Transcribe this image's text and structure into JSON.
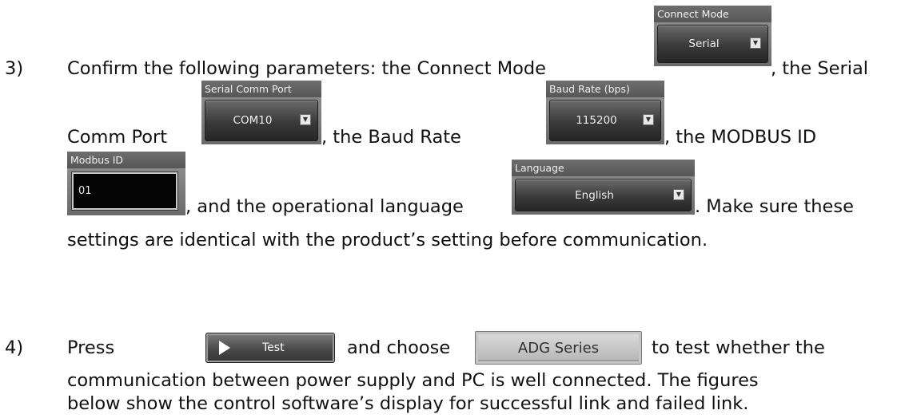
{
  "step3": {
    "number": "3)",
    "line1_a": "Confirm the following parameters:   the Connect Mode",
    "line1_b": ", the Serial",
    "line2_a": "Comm   Port",
    "line2_b": ",   the   Baud   Rate",
    "line2_c": ",   the   MODBUS   ID",
    "line3_a": ", and the operational language",
    "line3_b": ". Make sure these",
    "line4": "settings are identical with the product’s setting before communication."
  },
  "widgets": {
    "connect_mode": {
      "label": "Connect Mode",
      "value": "Serial"
    },
    "serial_comm_port": {
      "label": "Serial Comm Port",
      "value": "COM10"
    },
    "baud_rate": {
      "label": "Baud Rate (bps)",
      "value": "115200"
    },
    "modbus_id": {
      "label": "Modbus ID",
      "value": "01"
    },
    "language": {
      "label": "Language",
      "value": "English"
    }
  },
  "step4": {
    "number": "4)",
    "line1_a": "Press",
    "line1_b": "and   choose",
    "line1_c": "to   test   whether   the",
    "line2": "communication between power supply and PC is well connected. The figures",
    "line3": "below show the control software’s display for successful link and failed link."
  },
  "buttons": {
    "test_label": "Test",
    "adg_label": "ADG Series"
  },
  "icons": {
    "dropdown": "dropdown-arrow-icon",
    "play": "play-icon"
  }
}
